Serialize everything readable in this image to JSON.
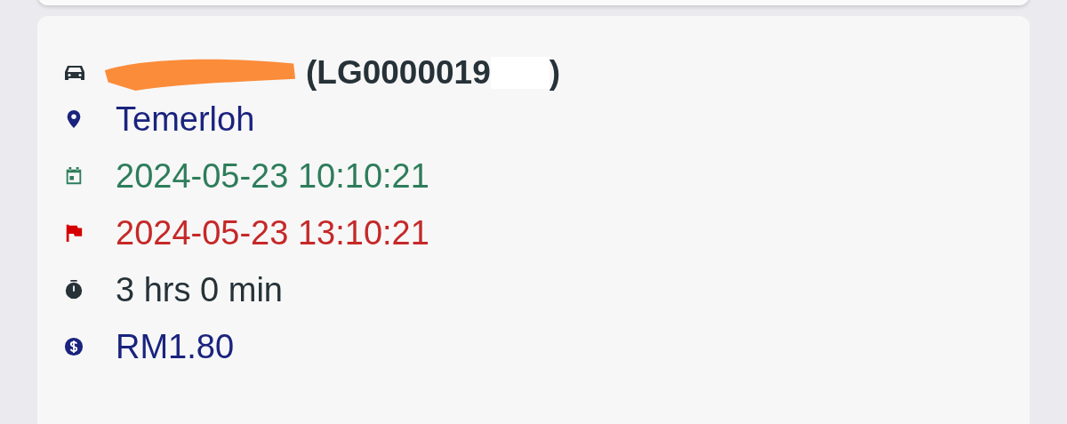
{
  "card": {
    "title_parts": [
      "(LG0000019",
      ")"
    ],
    "rows": [
      {
        "kind": "location",
        "text": "Temerloh"
      },
      {
        "kind": "start",
        "text": "2024-05-23 10:10:21"
      },
      {
        "kind": "end",
        "text": "2024-05-23 13:10:21"
      },
      {
        "kind": "duration",
        "text": "3 hrs 0 min"
      },
      {
        "kind": "fee",
        "text": "RM1.80"
      }
    ]
  }
}
